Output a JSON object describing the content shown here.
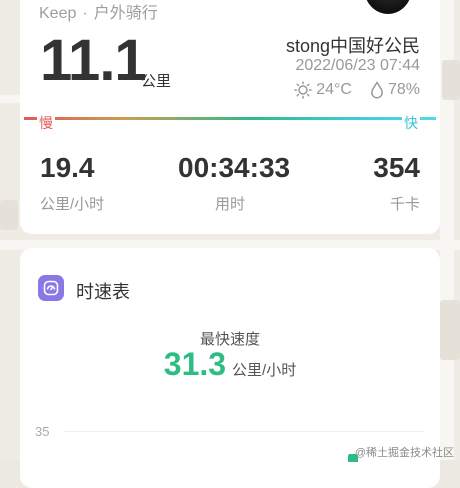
{
  "summary": {
    "brand": "Keep",
    "separator": "·",
    "activity_type": "户外骑行",
    "distance": "11.1",
    "distance_unit": "公里",
    "username": "stong中国好公民",
    "datetime": "2022/06/23 07:44",
    "temperature": "24°C",
    "humidity": "78%",
    "scale_slow": "慢",
    "scale_fast": "快",
    "stats": [
      {
        "value": "19.4",
        "label": "公里/小时"
      },
      {
        "value": "00:34:33",
        "label": "用时"
      },
      {
        "value": "354",
        "label": "千卡"
      }
    ]
  },
  "speed_section": {
    "title": "时速表",
    "fastest_label": "最快速度",
    "fastest_value": "31.3",
    "fastest_unit": "公里/小时",
    "axis_top": "35"
  },
  "watermark": "@稀土掘金技术社区",
  "colors": {
    "accent_green": "#2dbd84",
    "slow_red": "#e05a5a",
    "fast_cyan": "#38c4d8",
    "icon_purple": "#8a78e6"
  },
  "icons": [
    "sun-icon",
    "droplet-icon",
    "speedometer-icon",
    "avatar"
  ]
}
